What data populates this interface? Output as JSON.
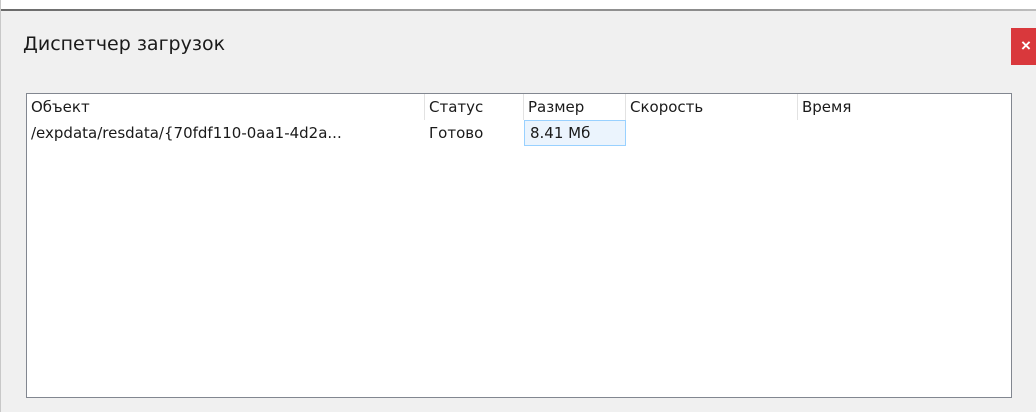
{
  "window": {
    "title": "Диспетчер загрузок",
    "close_label": "×"
  },
  "table": {
    "columns": [
      {
        "label": "Объект"
      },
      {
        "label": "Статус"
      },
      {
        "label": "Размер"
      },
      {
        "label": "Скорость"
      },
      {
        "label": "Время"
      }
    ],
    "rows": [
      {
        "object": "/expdata/resdata/{70fdf110-0aa1-4d2a...",
        "status": "Готово",
        "size": "8.41 Мб",
        "speed": "",
        "time": ""
      }
    ]
  },
  "colors": {
    "close_bg": "#d9383c",
    "background": "#f0f0f0",
    "selection_bg": "#ebf4fd",
    "selection_border": "#99d1ff"
  },
  "icons": {
    "close": "close-icon"
  }
}
